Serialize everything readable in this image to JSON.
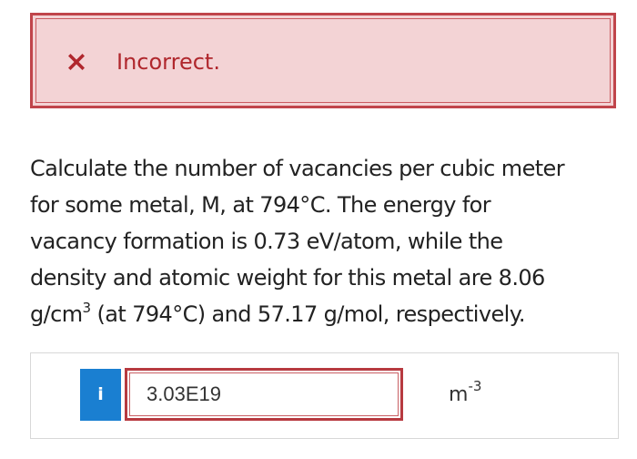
{
  "feedback": {
    "status_text": "Incorrect.",
    "icon": "close-x-icon",
    "color": "#b0272d",
    "background": "#f3d3d5"
  },
  "question": {
    "text_line1": "Calculate the number of vacancies per cubic meter",
    "text_line2": "for some metal, M, at 794°C. The energy for",
    "text_line3": "vacancy formation is 0.73 eV/atom, while the",
    "text_line4": "density and atomic weight for this metal are 8.06",
    "text_line5_start": "g/cm",
    "text_line5_sup": "3",
    "text_line5_end": " (at 794°C) and 57.17 g/mol, respectively."
  },
  "answer": {
    "info_label": "i",
    "value": "3.03E19",
    "unit_base": "m",
    "unit_exponent": "-3",
    "info_color": "#1a7fd1"
  }
}
